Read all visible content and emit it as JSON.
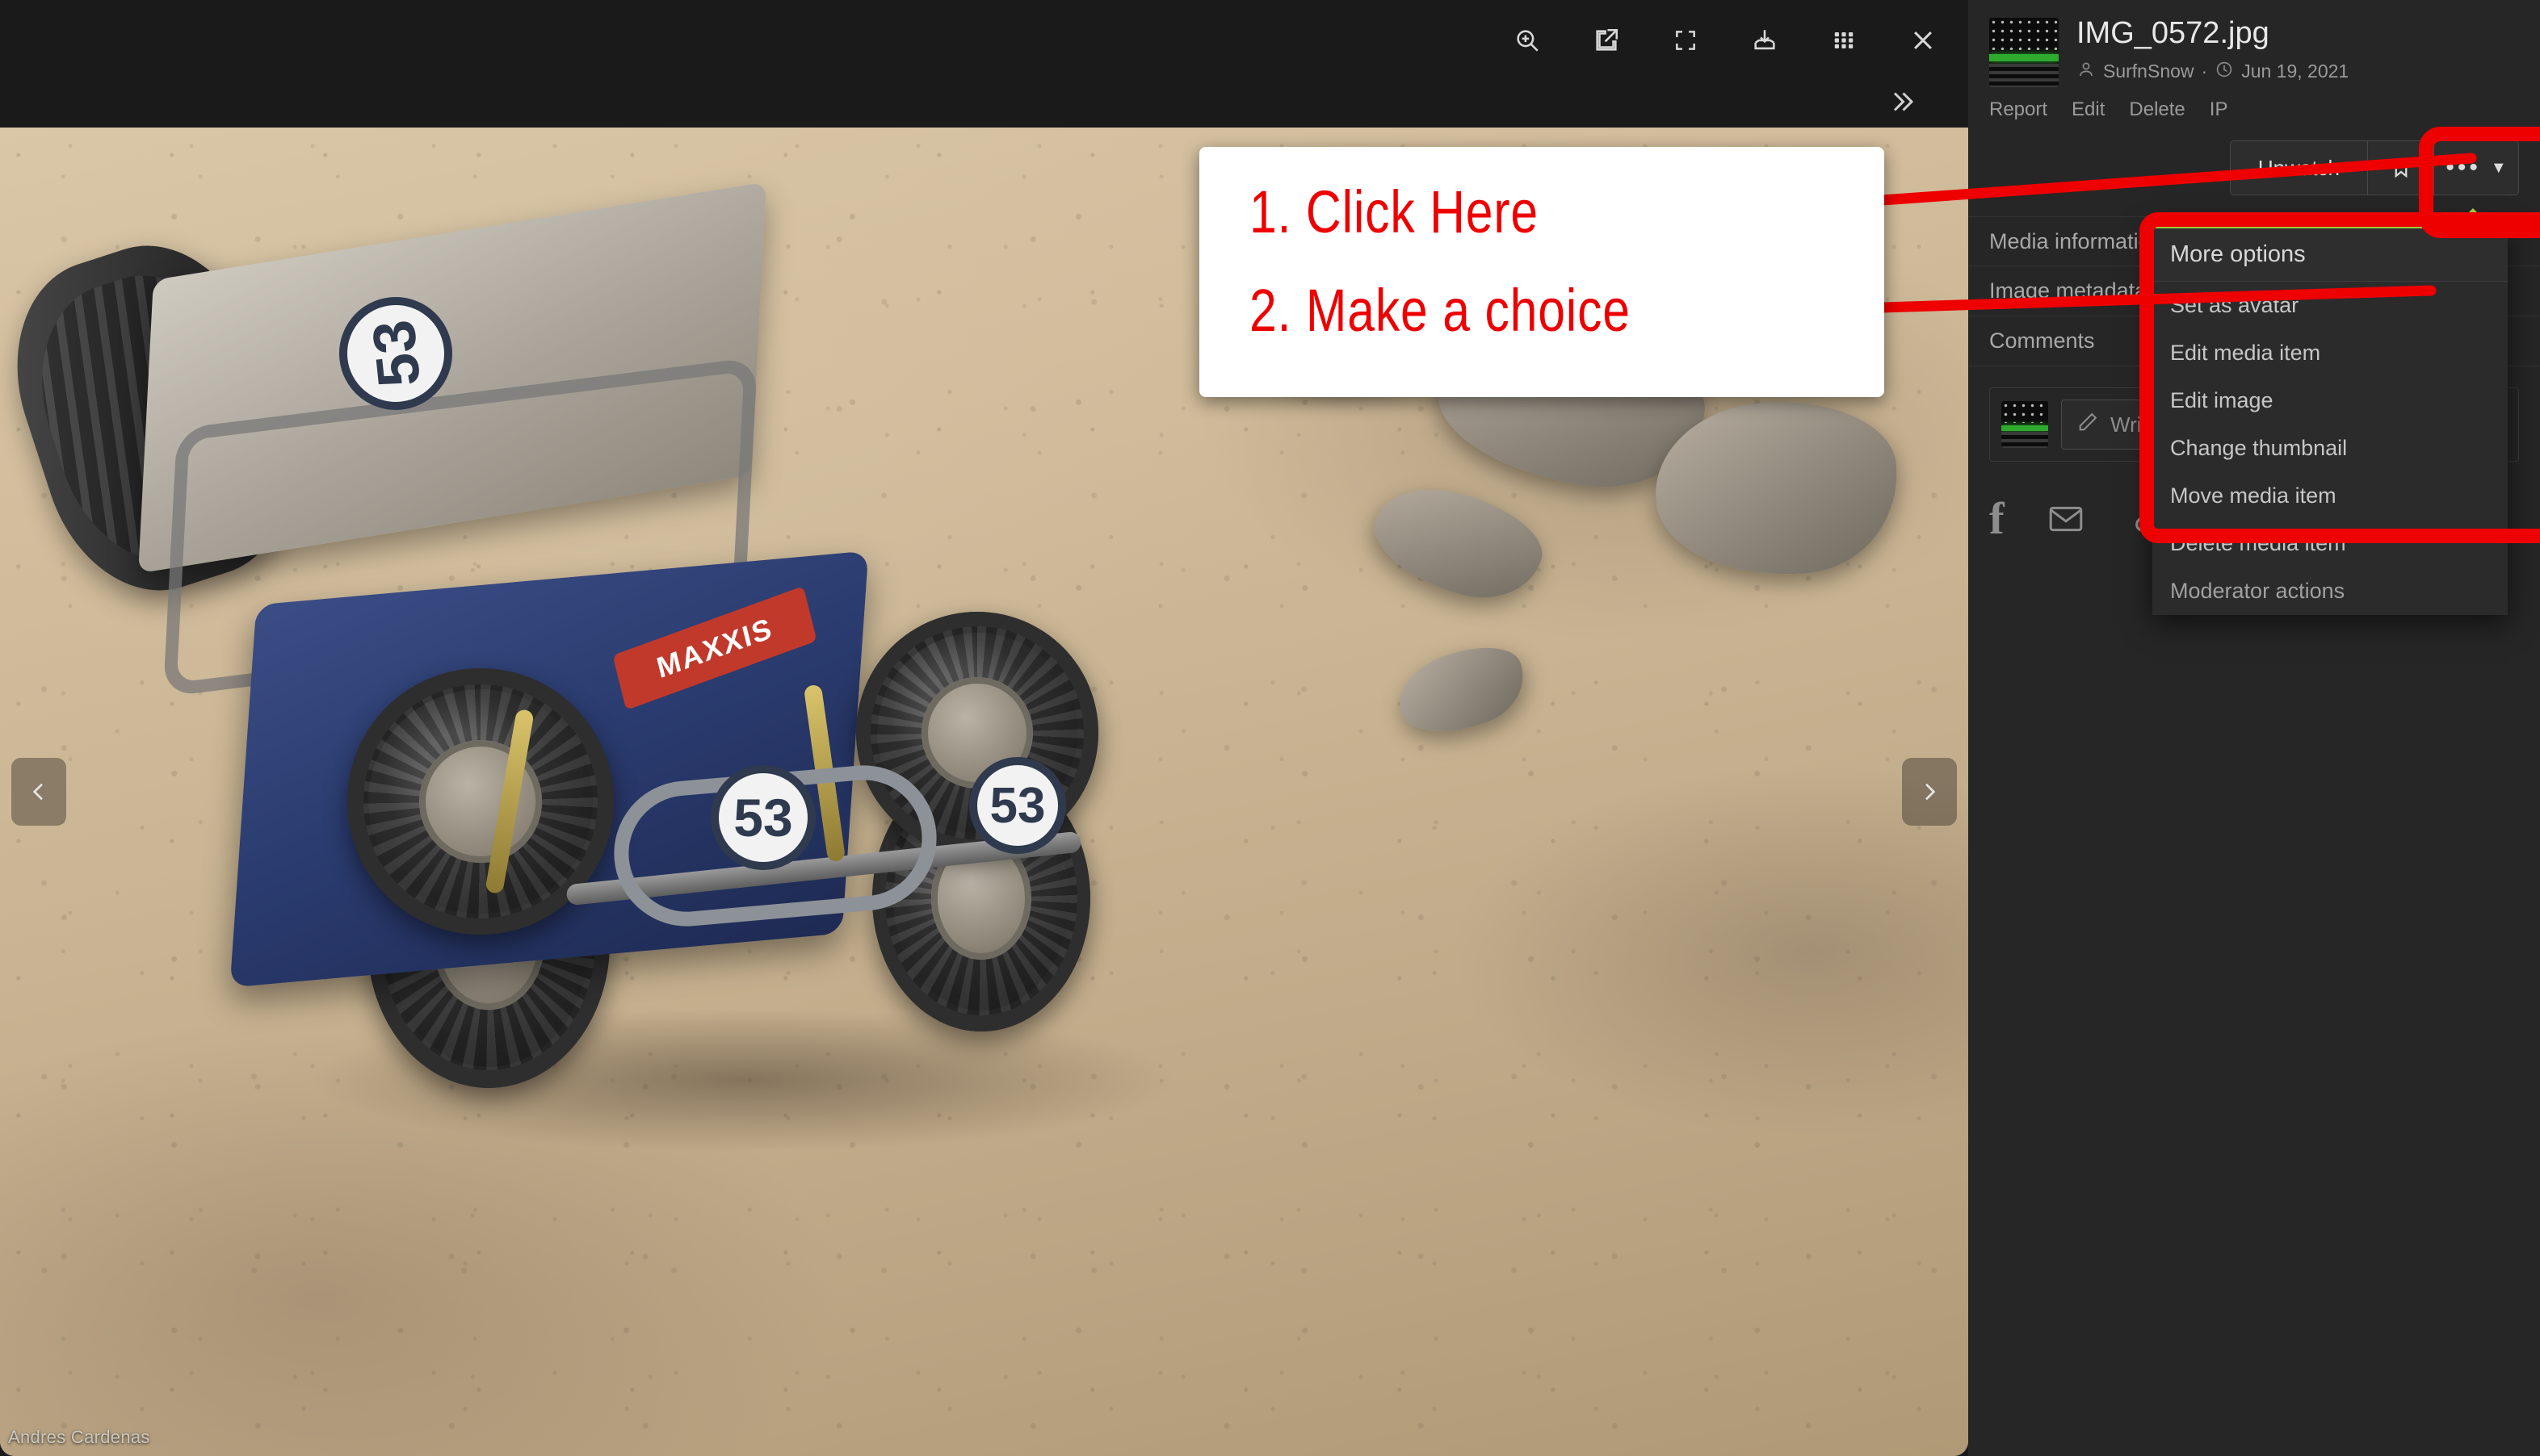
{
  "lightbox": {
    "toolbar": [
      {
        "name": "zoom-in-icon",
        "label": "Zoom in"
      },
      {
        "name": "open-external-icon",
        "label": "Open in new window"
      },
      {
        "name": "fullscreen-icon",
        "label": "Fullscreen"
      },
      {
        "name": "download-icon",
        "label": "Download"
      },
      {
        "name": "grid-view-icon",
        "label": "Grid view"
      },
      {
        "name": "close-icon",
        "label": "Close"
      }
    ],
    "collapse_label": "»",
    "prev_label": "‹",
    "next_label": "›",
    "watermark": "Andres Cardenas"
  },
  "sidebar": {
    "title": "IMG_0572.jpg",
    "author": "SurfnSnow",
    "separator": "·",
    "date": "Jun 19, 2021",
    "links": [
      "Report",
      "Edit",
      "Delete",
      "IP"
    ],
    "buttons": {
      "watch_label": "Unwatch",
      "bookmark_icon": "bookmark-icon",
      "more_dots": "•••",
      "more_caret": "▼"
    },
    "sections": [
      "Media information",
      "Image metadata",
      "Comments"
    ],
    "comment": {
      "placeholder": "Write a comment",
      "pencil_icon": "pencil-icon"
    },
    "share_icons": [
      "facebook-icon",
      "email-icon",
      "link-icon"
    ],
    "facebook_glyph": "f"
  },
  "dropdown": {
    "title": "More options",
    "items": [
      "Set as avatar",
      "Edit media item",
      "Edit image",
      "Change thumbnail",
      "Move media item",
      "Delete media item"
    ],
    "footer_item": "Moderator actions"
  },
  "annotation": {
    "line1": "1.  Click Here",
    "line2": "2. Make a choice",
    "color": "#ee0000"
  },
  "colors": {
    "accent_green": "#9fcc3b",
    "annotation_red": "#ee0000",
    "sidebar_bg": "#262626",
    "stage_bg": "#1a1a1a",
    "menu_bg": "#2b2b2b"
  }
}
